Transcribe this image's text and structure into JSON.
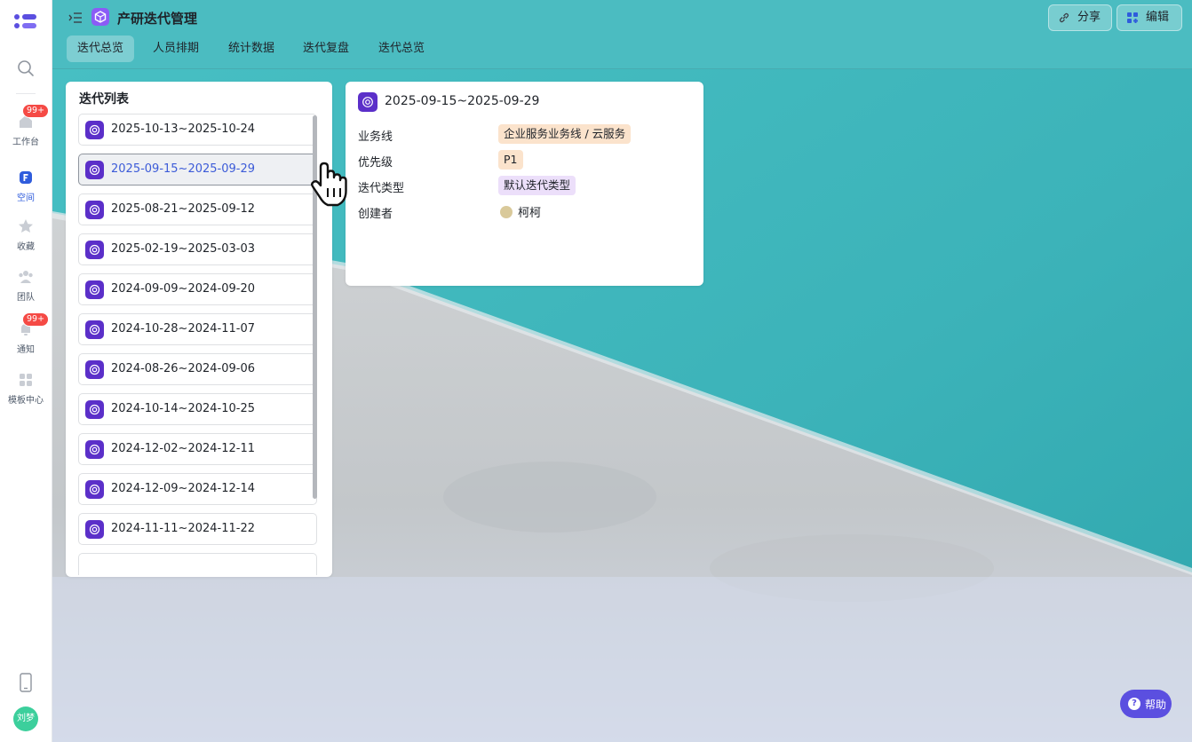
{
  "app": {
    "title": "产研迭代管理",
    "share_label": "分享",
    "edit_label": "编辑",
    "help_label": "帮助"
  },
  "sidebar": {
    "items": [
      {
        "label": "工作台",
        "badge": "99+"
      },
      {
        "label": "空间",
        "active": true
      },
      {
        "label": "收藏"
      },
      {
        "label": "团队"
      },
      {
        "label": "通知",
        "badge": "99+"
      },
      {
        "label": "模板中心"
      }
    ],
    "user_avatar_text": "刘梦"
  },
  "tabs": [
    {
      "label": "迭代总览",
      "active": true
    },
    {
      "label": "人员排期"
    },
    {
      "label": "统计数据"
    },
    {
      "label": "迭代复盘"
    },
    {
      "label": "迭代总览"
    }
  ],
  "iteration_list": {
    "title": "迭代列表",
    "selected_index": 1,
    "items": [
      "2025-10-13~2025-10-24",
      "2025-09-15~2025-09-29",
      "2025-08-21~2025-09-12",
      "2025-02-19~2025-03-03",
      "2024-09-09~2024-09-20",
      "2024-10-28~2024-11-07",
      "2024-08-26~2024-09-06",
      "2024-10-14~2024-10-25",
      "2024-12-02~2024-12-11",
      "2024-12-09~2024-12-14",
      "2024-11-11~2024-11-22"
    ]
  },
  "detail": {
    "title": "2025-09-15~2025-09-29",
    "fields": [
      {
        "label": "业务线",
        "value": "企业服务业务线 / 云服务",
        "tag_color": "#fbe3cc"
      },
      {
        "label": "优先级",
        "value": "P1",
        "tag_color": "#fbe3cc"
      },
      {
        "label": "迭代类型",
        "value": "默认迭代类型",
        "tag_color": "#ecdffa"
      },
      {
        "label": "创建者",
        "value": "柯柯"
      }
    ]
  },
  "colors": {
    "accent": "#2f5cdc",
    "iteration_icon": "#5b2fc9",
    "badge": "#f54a45",
    "help_button": "#5b4fe0"
  }
}
